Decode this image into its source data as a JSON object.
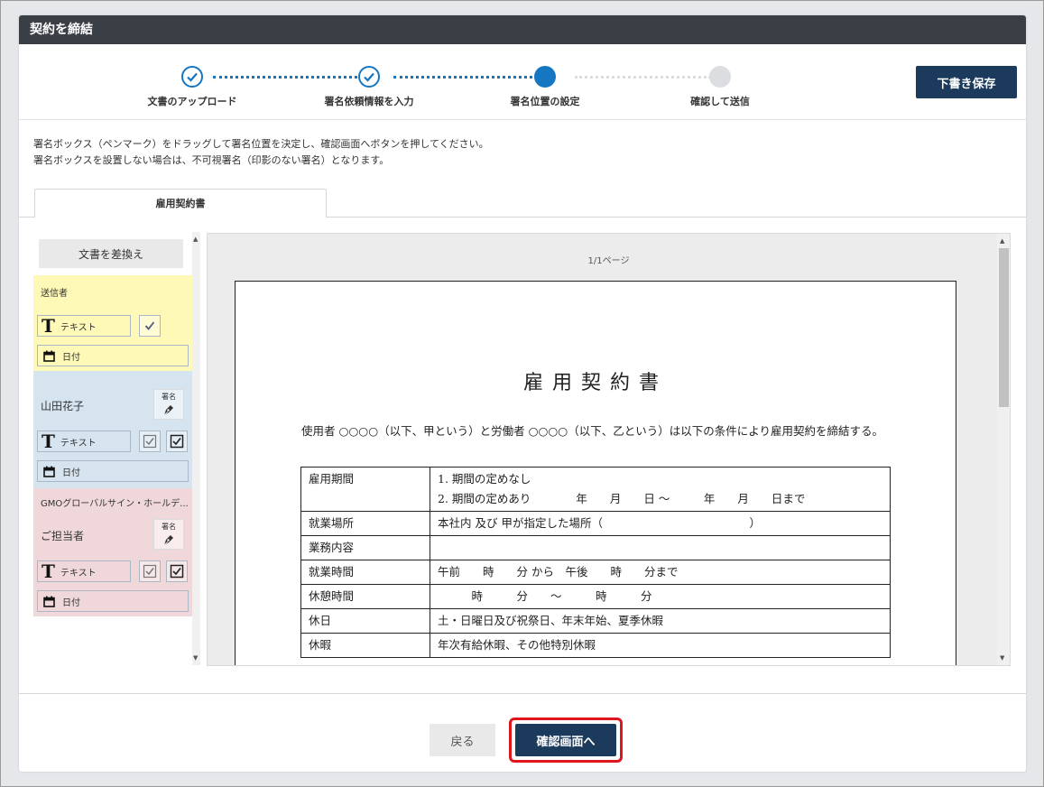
{
  "header": {
    "title": "契約を締結"
  },
  "stepper": {
    "steps": [
      {
        "label": "文書のアップロード",
        "state": "done"
      },
      {
        "label": "署名依頼情報を入力",
        "state": "done"
      },
      {
        "label": "署名位置の設定",
        "state": "current"
      },
      {
        "label": "確認して送信",
        "state": "todo"
      }
    ]
  },
  "toolbar": {
    "draft_label": "下書き保存"
  },
  "instructions": {
    "line1": "署名ボックス（ペンマーク）をドラッグして署名位置を決定し、確認画面へボタンを押してください。",
    "line2": "署名ボックスを設置しない場合は、不可視署名（印影のない署名）となります。"
  },
  "tabs": [
    {
      "label": "雇用契約書"
    }
  ],
  "sidebar": {
    "swap_label": "文書を差換え",
    "sender": {
      "name": "送信者",
      "text_label": "テキスト",
      "date_label": "日付"
    },
    "signer1": {
      "name": "山田花子",
      "sign_label": "署名",
      "text_label": "テキスト",
      "date_label": "日付"
    },
    "signer2": {
      "company": "GMOグローバルサイン・ホールデ...",
      "name": "ご担当者",
      "sign_label": "署名",
      "text_label": "テキスト",
      "date_label": "日付"
    }
  },
  "viewer": {
    "page_indicator": "1/1ページ"
  },
  "document": {
    "title": "雇用契約書",
    "intro": "使用者 ○○○○（以下、甲という）と労働者 ○○○○（以下、乙という）は以下の条件により雇用契約を締結する。",
    "rows": [
      {
        "label": "雇用期間",
        "value": "1. 期間の定めなし",
        "value2": "2. 期間の定めあり　　　　年　　月　　日 ～　　　年　　月　　日まで"
      },
      {
        "label": "就業場所",
        "value": "本社内 及び 甲が指定した場所（　　　　　　　　　　　　　）"
      },
      {
        "label": "業務内容",
        "value": ""
      },
      {
        "label": "就業時間",
        "value": "午前　　時　　分 から　午後　　時　　分まで"
      },
      {
        "label": "休憩時間",
        "value": "　　　時　　　分　　～　　　時　　　分"
      },
      {
        "label": "休日",
        "value": "土・日曜日及び祝祭日、年末年始、夏季休暇"
      },
      {
        "label": "休暇",
        "value": "年次有給休暇、その他特別休暇"
      }
    ]
  },
  "footer": {
    "back_label": "戻る",
    "confirm_label": "確認画面へ"
  },
  "colors": {
    "primary": "#1b3a5c",
    "accent": "#1576c2",
    "highlight": "#e0161e",
    "sender_bg": "#fff9b8",
    "signer1_bg": "#d5e4ef",
    "signer2_bg": "#f0d8da"
  }
}
